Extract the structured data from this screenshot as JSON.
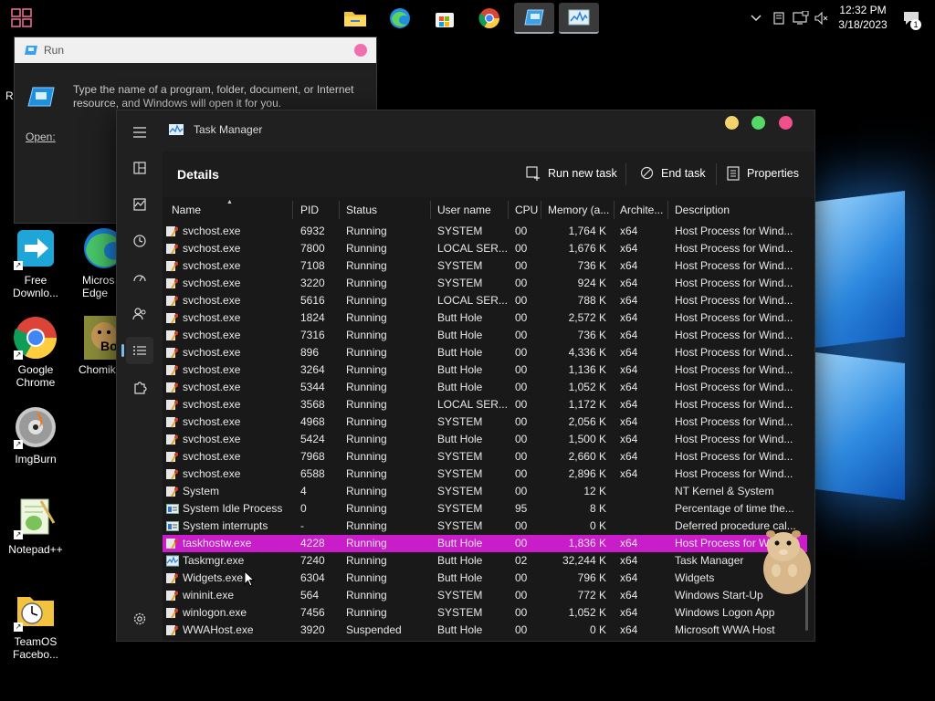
{
  "taskbar": {
    "clock_time": "12:32 PM",
    "clock_date": "3/18/2023",
    "notification_count": "1",
    "pinned": [
      "file-explorer",
      "edge",
      "store",
      "chrome",
      "run",
      "task-manager"
    ]
  },
  "desktop": {
    "partial_letter": "R",
    "icons": [
      {
        "label": "Free\nDownlo...",
        "icon": "download-arrow-icon"
      },
      {
        "label": "Micros\nEdge",
        "icon": "edge-icon"
      },
      {
        "label": "Google\nChrome",
        "icon": "chrome-icon"
      },
      {
        "label": "Chomik",
        "icon": "hamster-icon"
      },
      {
        "label": "ImgBurn",
        "icon": "disc-icon"
      },
      {
        "label": "Notepad++",
        "icon": "notepad-icon"
      },
      {
        "label": "TeamOS\nFacebo...",
        "icon": "folder-clock-icon"
      }
    ],
    "chomik_badge": "Bo"
  },
  "run_dialog": {
    "title": "Run",
    "message": "Type the name of a program, folder, document, or Internet resource, and Windows will open it for you.",
    "open_label": "Open:"
  },
  "task_manager": {
    "title": "Task Manager",
    "page": "Details",
    "toolbar": {
      "run_new_task": "Run new task",
      "end_task": "End task",
      "properties": "Properties"
    },
    "columns": [
      "Name",
      "PID",
      "Status",
      "User name",
      "CPU",
      "Memory (a...",
      "Archite...",
      "Description"
    ],
    "rows": [
      {
        "name": "svchost.exe",
        "pid": "6932",
        "status": "Running",
        "user": "SYSTEM",
        "cpu": "00",
        "mem": "1,764 K",
        "arch": "x64",
        "desc": "Host Process for Wind...",
        "icon": "gear"
      },
      {
        "name": "svchost.exe",
        "pid": "7800",
        "status": "Running",
        "user": "LOCAL SER...",
        "cpu": "00",
        "mem": "1,676 K",
        "arch": "x64",
        "desc": "Host Process for Wind...",
        "icon": "gear"
      },
      {
        "name": "svchost.exe",
        "pid": "7108",
        "status": "Running",
        "user": "SYSTEM",
        "cpu": "00",
        "mem": "736 K",
        "arch": "x64",
        "desc": "Host Process for Wind...",
        "icon": "gear"
      },
      {
        "name": "svchost.exe",
        "pid": "3220",
        "status": "Running",
        "user": "SYSTEM",
        "cpu": "00",
        "mem": "924 K",
        "arch": "x64",
        "desc": "Host Process for Wind...",
        "icon": "gear"
      },
      {
        "name": "svchost.exe",
        "pid": "5616",
        "status": "Running",
        "user": "LOCAL SER...",
        "cpu": "00",
        "mem": "788 K",
        "arch": "x64",
        "desc": "Host Process for Wind...",
        "icon": "gear"
      },
      {
        "name": "svchost.exe",
        "pid": "1824",
        "status": "Running",
        "user": "Butt Hole",
        "cpu": "00",
        "mem": "2,572 K",
        "arch": "x64",
        "desc": "Host Process for Wind...",
        "icon": "gear"
      },
      {
        "name": "svchost.exe",
        "pid": "7316",
        "status": "Running",
        "user": "Butt Hole",
        "cpu": "00",
        "mem": "736 K",
        "arch": "x64",
        "desc": "Host Process for Wind...",
        "icon": "gear"
      },
      {
        "name": "svchost.exe",
        "pid": "896",
        "status": "Running",
        "user": "Butt Hole",
        "cpu": "00",
        "mem": "4,336 K",
        "arch": "x64",
        "desc": "Host Process for Wind...",
        "icon": "gear"
      },
      {
        "name": "svchost.exe",
        "pid": "3264",
        "status": "Running",
        "user": "Butt Hole",
        "cpu": "00",
        "mem": "1,136 K",
        "arch": "x64",
        "desc": "Host Process for Wind...",
        "icon": "gear"
      },
      {
        "name": "svchost.exe",
        "pid": "5344",
        "status": "Running",
        "user": "Butt Hole",
        "cpu": "00",
        "mem": "1,052 K",
        "arch": "x64",
        "desc": "Host Process for Wind...",
        "icon": "gear"
      },
      {
        "name": "svchost.exe",
        "pid": "3568",
        "status": "Running",
        "user": "LOCAL SER...",
        "cpu": "00",
        "mem": "1,172 K",
        "arch": "x64",
        "desc": "Host Process for Wind...",
        "icon": "gear"
      },
      {
        "name": "svchost.exe",
        "pid": "4968",
        "status": "Running",
        "user": "SYSTEM",
        "cpu": "00",
        "mem": "2,056 K",
        "arch": "x64",
        "desc": "Host Process for Wind...",
        "icon": "gear"
      },
      {
        "name": "svchost.exe",
        "pid": "5424",
        "status": "Running",
        "user": "Butt Hole",
        "cpu": "00",
        "mem": "1,500 K",
        "arch": "x64",
        "desc": "Host Process for Wind...",
        "icon": "gear"
      },
      {
        "name": "svchost.exe",
        "pid": "7968",
        "status": "Running",
        "user": "SYSTEM",
        "cpu": "00",
        "mem": "2,660 K",
        "arch": "x64",
        "desc": "Host Process for Wind...",
        "icon": "gear"
      },
      {
        "name": "svchost.exe",
        "pid": "6588",
        "status": "Running",
        "user": "SYSTEM",
        "cpu": "00",
        "mem": "2,896 K",
        "arch": "x64",
        "desc": "Host Process for Wind...",
        "icon": "gear"
      },
      {
        "name": "System",
        "pid": "4",
        "status": "Running",
        "user": "SYSTEM",
        "cpu": "00",
        "mem": "12 K",
        "arch": "",
        "desc": "NT Kernel & System",
        "icon": "gear"
      },
      {
        "name": "System Idle Process",
        "pid": "0",
        "status": "Running",
        "user": "SYSTEM",
        "cpu": "95",
        "mem": "8 K",
        "arch": "",
        "desc": "Percentage of time the...",
        "icon": "window"
      },
      {
        "name": "System interrupts",
        "pid": "-",
        "status": "Running",
        "user": "SYSTEM",
        "cpu": "00",
        "mem": "0 K",
        "arch": "",
        "desc": "Deferred procedure cal...",
        "icon": "window"
      },
      {
        "name": "taskhostw.exe",
        "pid": "4228",
        "status": "Running",
        "user": "Butt Hole",
        "cpu": "00",
        "mem": "1,836 K",
        "arch": "x64",
        "desc": "Host Process for W",
        "icon": "gear",
        "selected": true
      },
      {
        "name": "Taskmgr.exe",
        "pid": "7240",
        "status": "Running",
        "user": "Butt Hole",
        "cpu": "02",
        "mem": "32,244 K",
        "arch": "x64",
        "desc": "Task Manager",
        "icon": "taskmgr"
      },
      {
        "name": "Widgets.exe",
        "pid": "6304",
        "status": "Running",
        "user": "Butt Hole",
        "cpu": "00",
        "mem": "796 K",
        "arch": "x64",
        "desc": "Widgets",
        "icon": "gear"
      },
      {
        "name": "wininit.exe",
        "pid": "564",
        "status": "Running",
        "user": "SYSTEM",
        "cpu": "00",
        "mem": "772 K",
        "arch": "x64",
        "desc": "Windows Start-Up",
        "icon": "gear"
      },
      {
        "name": "winlogon.exe",
        "pid": "7456",
        "status": "Running",
        "user": "SYSTEM",
        "cpu": "00",
        "mem": "1,052 K",
        "arch": "x64",
        "desc": "Windows Logon App",
        "icon": "gear"
      },
      {
        "name": "WWAHost.exe",
        "pid": "3920",
        "status": "Suspended",
        "user": "Butt Hole",
        "cpu": "00",
        "mem": "0 K",
        "arch": "x64",
        "desc": "Microsoft WWA Host",
        "icon": "gear"
      }
    ]
  },
  "colors": {
    "selection": "#c81dc8",
    "traffic_yellow": "#f3d36b",
    "traffic_green": "#54d868",
    "traffic_red": "#f04f8b",
    "run_close": "#f06fae"
  }
}
